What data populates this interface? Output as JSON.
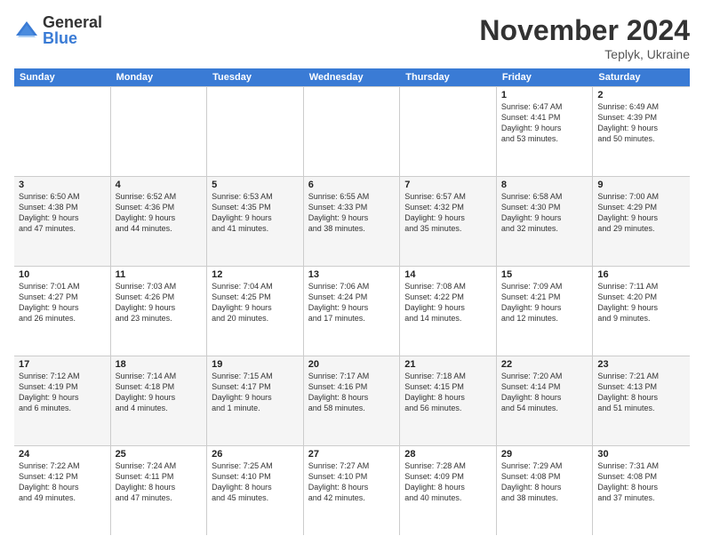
{
  "logo": {
    "general": "General",
    "blue": "Blue"
  },
  "title": "November 2024",
  "location": "Teplyk, Ukraine",
  "days_of_week": [
    "Sunday",
    "Monday",
    "Tuesday",
    "Wednesday",
    "Thursday",
    "Friday",
    "Saturday"
  ],
  "weeks": [
    {
      "alt": false,
      "days": [
        {
          "num": "",
          "info": ""
        },
        {
          "num": "",
          "info": ""
        },
        {
          "num": "",
          "info": ""
        },
        {
          "num": "",
          "info": ""
        },
        {
          "num": "",
          "info": ""
        },
        {
          "num": "1",
          "info": "Sunrise: 6:47 AM\nSunset: 4:41 PM\nDaylight: 9 hours\nand 53 minutes."
        },
        {
          "num": "2",
          "info": "Sunrise: 6:49 AM\nSunset: 4:39 PM\nDaylight: 9 hours\nand 50 minutes."
        }
      ]
    },
    {
      "alt": true,
      "days": [
        {
          "num": "3",
          "info": "Sunrise: 6:50 AM\nSunset: 4:38 PM\nDaylight: 9 hours\nand 47 minutes."
        },
        {
          "num": "4",
          "info": "Sunrise: 6:52 AM\nSunset: 4:36 PM\nDaylight: 9 hours\nand 44 minutes."
        },
        {
          "num": "5",
          "info": "Sunrise: 6:53 AM\nSunset: 4:35 PM\nDaylight: 9 hours\nand 41 minutes."
        },
        {
          "num": "6",
          "info": "Sunrise: 6:55 AM\nSunset: 4:33 PM\nDaylight: 9 hours\nand 38 minutes."
        },
        {
          "num": "7",
          "info": "Sunrise: 6:57 AM\nSunset: 4:32 PM\nDaylight: 9 hours\nand 35 minutes."
        },
        {
          "num": "8",
          "info": "Sunrise: 6:58 AM\nSunset: 4:30 PM\nDaylight: 9 hours\nand 32 minutes."
        },
        {
          "num": "9",
          "info": "Sunrise: 7:00 AM\nSunset: 4:29 PM\nDaylight: 9 hours\nand 29 minutes."
        }
      ]
    },
    {
      "alt": false,
      "days": [
        {
          "num": "10",
          "info": "Sunrise: 7:01 AM\nSunset: 4:27 PM\nDaylight: 9 hours\nand 26 minutes."
        },
        {
          "num": "11",
          "info": "Sunrise: 7:03 AM\nSunset: 4:26 PM\nDaylight: 9 hours\nand 23 minutes."
        },
        {
          "num": "12",
          "info": "Sunrise: 7:04 AM\nSunset: 4:25 PM\nDaylight: 9 hours\nand 20 minutes."
        },
        {
          "num": "13",
          "info": "Sunrise: 7:06 AM\nSunset: 4:24 PM\nDaylight: 9 hours\nand 17 minutes."
        },
        {
          "num": "14",
          "info": "Sunrise: 7:08 AM\nSunset: 4:22 PM\nDaylight: 9 hours\nand 14 minutes."
        },
        {
          "num": "15",
          "info": "Sunrise: 7:09 AM\nSunset: 4:21 PM\nDaylight: 9 hours\nand 12 minutes."
        },
        {
          "num": "16",
          "info": "Sunrise: 7:11 AM\nSunset: 4:20 PM\nDaylight: 9 hours\nand 9 minutes."
        }
      ]
    },
    {
      "alt": true,
      "days": [
        {
          "num": "17",
          "info": "Sunrise: 7:12 AM\nSunset: 4:19 PM\nDaylight: 9 hours\nand 6 minutes."
        },
        {
          "num": "18",
          "info": "Sunrise: 7:14 AM\nSunset: 4:18 PM\nDaylight: 9 hours\nand 4 minutes."
        },
        {
          "num": "19",
          "info": "Sunrise: 7:15 AM\nSunset: 4:17 PM\nDaylight: 9 hours\nand 1 minute."
        },
        {
          "num": "20",
          "info": "Sunrise: 7:17 AM\nSunset: 4:16 PM\nDaylight: 8 hours\nand 58 minutes."
        },
        {
          "num": "21",
          "info": "Sunrise: 7:18 AM\nSunset: 4:15 PM\nDaylight: 8 hours\nand 56 minutes."
        },
        {
          "num": "22",
          "info": "Sunrise: 7:20 AM\nSunset: 4:14 PM\nDaylight: 8 hours\nand 54 minutes."
        },
        {
          "num": "23",
          "info": "Sunrise: 7:21 AM\nSunset: 4:13 PM\nDaylight: 8 hours\nand 51 minutes."
        }
      ]
    },
    {
      "alt": false,
      "days": [
        {
          "num": "24",
          "info": "Sunrise: 7:22 AM\nSunset: 4:12 PM\nDaylight: 8 hours\nand 49 minutes."
        },
        {
          "num": "25",
          "info": "Sunrise: 7:24 AM\nSunset: 4:11 PM\nDaylight: 8 hours\nand 47 minutes."
        },
        {
          "num": "26",
          "info": "Sunrise: 7:25 AM\nSunset: 4:10 PM\nDaylight: 8 hours\nand 45 minutes."
        },
        {
          "num": "27",
          "info": "Sunrise: 7:27 AM\nSunset: 4:10 PM\nDaylight: 8 hours\nand 42 minutes."
        },
        {
          "num": "28",
          "info": "Sunrise: 7:28 AM\nSunset: 4:09 PM\nDaylight: 8 hours\nand 40 minutes."
        },
        {
          "num": "29",
          "info": "Sunrise: 7:29 AM\nSunset: 4:08 PM\nDaylight: 8 hours\nand 38 minutes."
        },
        {
          "num": "30",
          "info": "Sunrise: 7:31 AM\nSunset: 4:08 PM\nDaylight: 8 hours\nand 37 minutes."
        }
      ]
    }
  ]
}
